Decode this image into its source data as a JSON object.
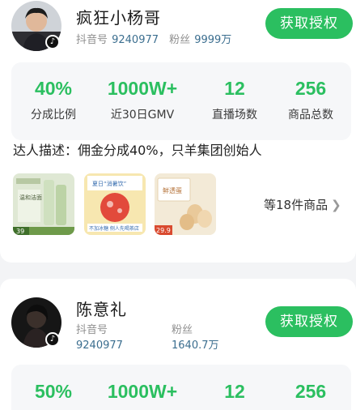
{
  "influencers": [
    {
      "name": "疯狂小杨哥",
      "douyin_label": "抖音号",
      "douyin_id": "9240977",
      "fans_label": "粉丝",
      "fans_value": "9999万",
      "auth_button": "获取授权",
      "stats": [
        {
          "value": "40%",
          "label": "分成比例"
        },
        {
          "value": "1000W+",
          "label": "近30日GMV"
        },
        {
          "value": "12",
          "label": "直播场数"
        },
        {
          "value": "256",
          "label": "商品总数"
        }
      ],
      "description": "达人描述：佣金分成40%，只羊集团创始人",
      "products": [
        {
          "icon": "skincare-product-thumb",
          "price": "39",
          "tag": "温和洁面"
        },
        {
          "icon": "drink-product-thumb",
          "top": "夏日“消暑饮”",
          "bottom": "不加冰糖 侧人先喝茶店"
        },
        {
          "icon": "egg-product-thumb",
          "price": "29.9",
          "title": "鲜透蛋"
        }
      ],
      "more_label": "等18件商品",
      "more_icon": "chevron-right-icon"
    },
    {
      "name": "陈意礼",
      "douyin_label": "抖音号",
      "douyin_id": "9240977",
      "fans_label": "粉丝",
      "fans_value": "1640.7万",
      "auth_button": "获取授权",
      "stats": [
        {
          "value": "50%"
        },
        {
          "value": "1000W+"
        },
        {
          "value": "12"
        },
        {
          "value": "256"
        }
      ]
    }
  ],
  "colors": {
    "accent": "#2bbf60",
    "id_value": "#3b6e8f",
    "muted": "#8f8f8f"
  }
}
